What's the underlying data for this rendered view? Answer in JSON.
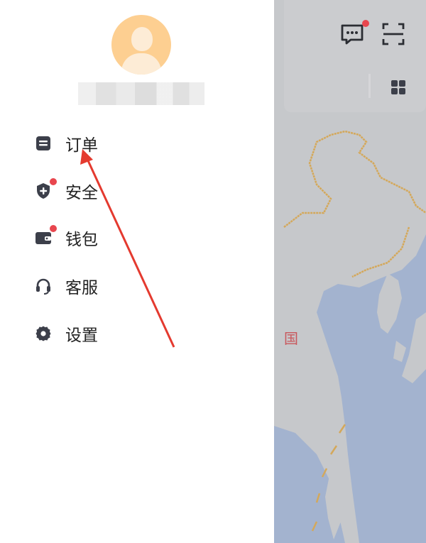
{
  "drawer": {
    "avatar_icon": "user-avatar-placeholder",
    "username": "",
    "menu": [
      {
        "id": "orders",
        "label": "订单",
        "icon": "order-list-icon",
        "badge": false
      },
      {
        "id": "security",
        "label": "安全",
        "icon": "shield-plus-icon",
        "badge": true
      },
      {
        "id": "wallet",
        "label": "钱包",
        "icon": "wallet-icon",
        "badge": true
      },
      {
        "id": "support",
        "label": "客服",
        "icon": "headset-icon",
        "badge": false
      },
      {
        "id": "settings",
        "label": "设置",
        "icon": "gear-icon",
        "badge": false
      }
    ]
  },
  "map": {
    "label": "国",
    "top_icons": [
      "message-icon",
      "scan-icon",
      "grid-icon"
    ],
    "message_badge": true
  },
  "annotation": {
    "type": "arrow",
    "color": "#e43a2f",
    "target": "orders"
  },
  "colors": {
    "badge": "#e8464e",
    "avatar_bg": "#fdcf91",
    "icon": "#3c3f4a",
    "map_land": "#c6c8cb",
    "map_sea": "#a3b3cf",
    "map_border": "#d4a85a"
  }
}
